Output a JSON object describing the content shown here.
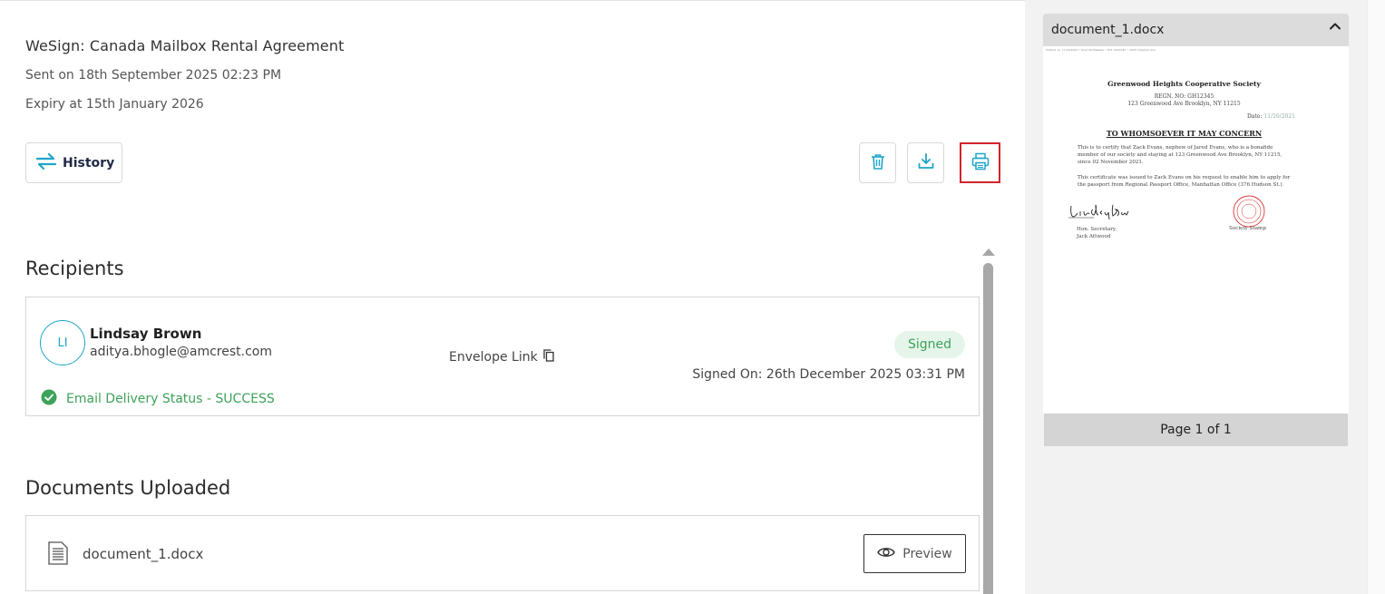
{
  "envelope": {
    "title": "WeSign: Canada Mailbox Rental Agreement",
    "sent_on": "Sent on 18th September 2025 02:23 PM",
    "expiry": "Expiry at 15th January 2026"
  },
  "toolbar": {
    "history_label": "History",
    "delete_icon": "trash-icon",
    "download_icon": "download-icon",
    "print_icon": "printer-icon"
  },
  "recipients": {
    "heading": "Recipients",
    "items": [
      {
        "initials": "LI",
        "name": "Lindsay Brown",
        "email": "aditya.bhogle@amcrest.com",
        "envelope_link_label": "Envelope Link",
        "status": "Signed",
        "signed_on": "Signed On: 26th December 2025 03:31 PM",
        "delivery_status": "Email Delivery Status - SUCCESS"
      }
    ]
  },
  "documents": {
    "heading": "Documents Uploaded",
    "items": [
      {
        "name": "document_1.docx",
        "preview_label": "Preview"
      }
    ]
  },
  "viewer": {
    "file_name": "document_1.docx",
    "page_indicator": "Page 1 of 1",
    "page": {
      "tiny_header": "Printed on: 11/26/2025 • Dear Sir/Madam • Ref: 0022345 • 3326 Chestnut Ave",
      "org_name": "Greenwood Heights Cooperative Society",
      "regn": "REGN. NO: GH12345",
      "address": "123 Greenwood Ave Brooklyn, NY 11215",
      "date_label": "Date:",
      "date_value": "11/26/2021",
      "heading": "TO WHOMSOEVER IT MAY CONCERN",
      "para1": "This is to certify that Zack Evans, nephew of Jared Evans, who is a bonafide member of our society and staying at 123 Greenwood Ave Brooklyn, NY 11215, since 02 November 2021.",
      "para2": "This certificate was issued to Zack Evans on his request to enable him to apply for the passport from Regional Passport Office, Manhattan Office (376 Hudson St.).",
      "signature": "Lindsay Brown",
      "secretary_line1": "Hon. Secretary,",
      "secretary_line2": "Jack Attwood",
      "stamp_label": "Society Stamp"
    }
  },
  "colors": {
    "accent": "#1fa5c9",
    "success": "#3da25a",
    "highlight_border": "#d0242b"
  }
}
